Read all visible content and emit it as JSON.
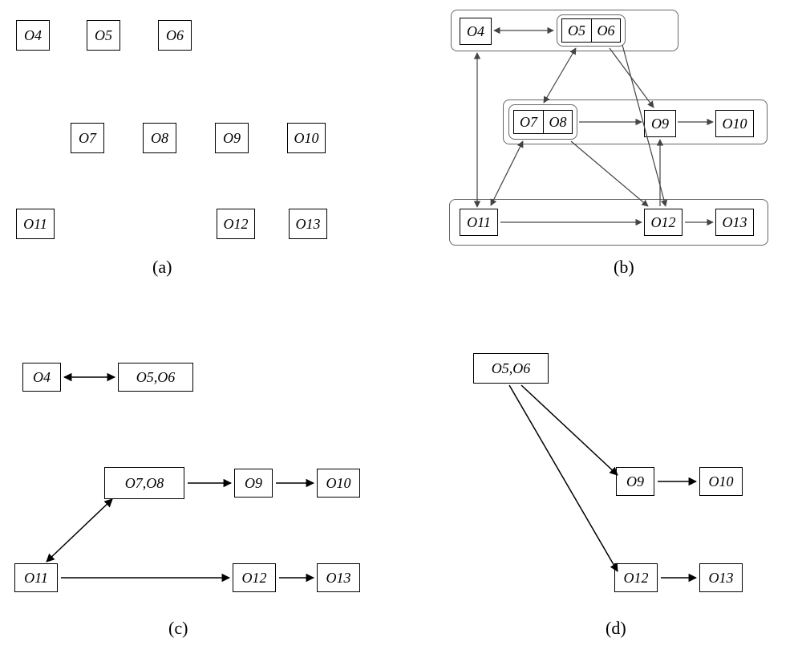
{
  "panels": {
    "a": {
      "caption": "(a)",
      "nodes": {
        "o4": "O4",
        "o5": "O5",
        "o6": "O6",
        "o7": "O7",
        "o8": "O8",
        "o9": "O9",
        "o10": "O10",
        "o11": "O11",
        "o12": "O12",
        "o13": "O13"
      }
    },
    "b": {
      "caption": "(b)",
      "nodes": {
        "o4": "O4",
        "o5": "O5",
        "o6": "O6",
        "o7": "O7",
        "o8": "O8",
        "o9": "O9",
        "o10": "O10",
        "o11": "O11",
        "o12": "O12",
        "o13": "O13"
      }
    },
    "c": {
      "caption": "(c)",
      "nodes": {
        "o4": "O4",
        "o56": "O5,O6",
        "o78": "O7,O8",
        "o9": "O9",
        "o10": "O10",
        "o11": "O11",
        "o12": "O12",
        "o13": "O13"
      }
    },
    "d": {
      "caption": "(d)",
      "nodes": {
        "o56": "O5,O6",
        "o9": "O9",
        "o10": "O10",
        "o12": "O12",
        "o13": "O13"
      }
    }
  },
  "chart_data": [
    {
      "id": "a",
      "type": "diagram",
      "description": "Ten isolated nodes O4 through O13 arranged in three rows with no edges",
      "nodes": [
        "O4",
        "O5",
        "O6",
        "O7",
        "O8",
        "O9",
        "O10",
        "O11",
        "O12",
        "O13"
      ],
      "edges": []
    },
    {
      "id": "b",
      "type": "diagram",
      "description": "Same ten nodes with grouping containers and directed/bidirectional edges",
      "nodes": [
        "O4",
        "O5",
        "O6",
        "O7",
        "O8",
        "O9",
        "O10",
        "O11",
        "O12",
        "O13"
      ],
      "groups": [
        [
          "O5",
          "O6"
        ],
        [
          "O4",
          "O5",
          "O6"
        ],
        [
          "O7",
          "O8"
        ],
        [
          "O7",
          "O8",
          "O9",
          "O10"
        ],
        [
          "O11",
          "O12",
          "O13"
        ]
      ],
      "edges": [
        {
          "from": "O4",
          "to": "O5/O6",
          "dir": "both"
        },
        {
          "from": "O4/O5/O6",
          "to": "O11",
          "dir": "both"
        },
        {
          "from": "O5/O6",
          "to": "O7/O8",
          "dir": "both"
        },
        {
          "from": "O5/O6",
          "to": "O9",
          "dir": "forward"
        },
        {
          "from": "O5/O6",
          "to": "O12",
          "dir": "forward"
        },
        {
          "from": "O7/O8",
          "to": "O9",
          "dir": "forward"
        },
        {
          "from": "O7/O8",
          "to": "O12",
          "dir": "forward"
        },
        {
          "from": "O9",
          "to": "O10",
          "dir": "forward"
        },
        {
          "from": "O11",
          "to": "O7/O8",
          "dir": "both"
        },
        {
          "from": "O11",
          "to": "O12",
          "dir": "forward"
        },
        {
          "from": "O12",
          "to": "O9",
          "dir": "forward"
        },
        {
          "from": "O12",
          "to": "O13",
          "dir": "forward"
        }
      ]
    },
    {
      "id": "c",
      "type": "diagram",
      "description": "Merged-node diagram with two components",
      "nodes": [
        "O4",
        "O5,O6",
        "O7,O8",
        "O9",
        "O10",
        "O11",
        "O12",
        "O13"
      ],
      "edges": [
        {
          "from": "O4",
          "to": "O5,O6",
          "dir": "both"
        },
        {
          "from": "O11",
          "to": "O7,O8",
          "dir": "both"
        },
        {
          "from": "O7,O8",
          "to": "O9",
          "dir": "forward"
        },
        {
          "from": "O9",
          "to": "O10",
          "dir": "forward"
        },
        {
          "from": "O11",
          "to": "O12",
          "dir": "forward"
        },
        {
          "from": "O12",
          "to": "O13",
          "dir": "forward"
        }
      ]
    },
    {
      "id": "d",
      "type": "diagram",
      "description": "Reduced diagram rooted at merged node O5,O6",
      "nodes": [
        "O5,O6",
        "O9",
        "O10",
        "O12",
        "O13"
      ],
      "edges": [
        {
          "from": "O5,O6",
          "to": "O9",
          "dir": "forward"
        },
        {
          "from": "O5,O6",
          "to": "O12",
          "dir": "forward"
        },
        {
          "from": "O9",
          "to": "O10",
          "dir": "forward"
        },
        {
          "from": "O12",
          "to": "O13",
          "dir": "forward"
        }
      ]
    }
  ]
}
